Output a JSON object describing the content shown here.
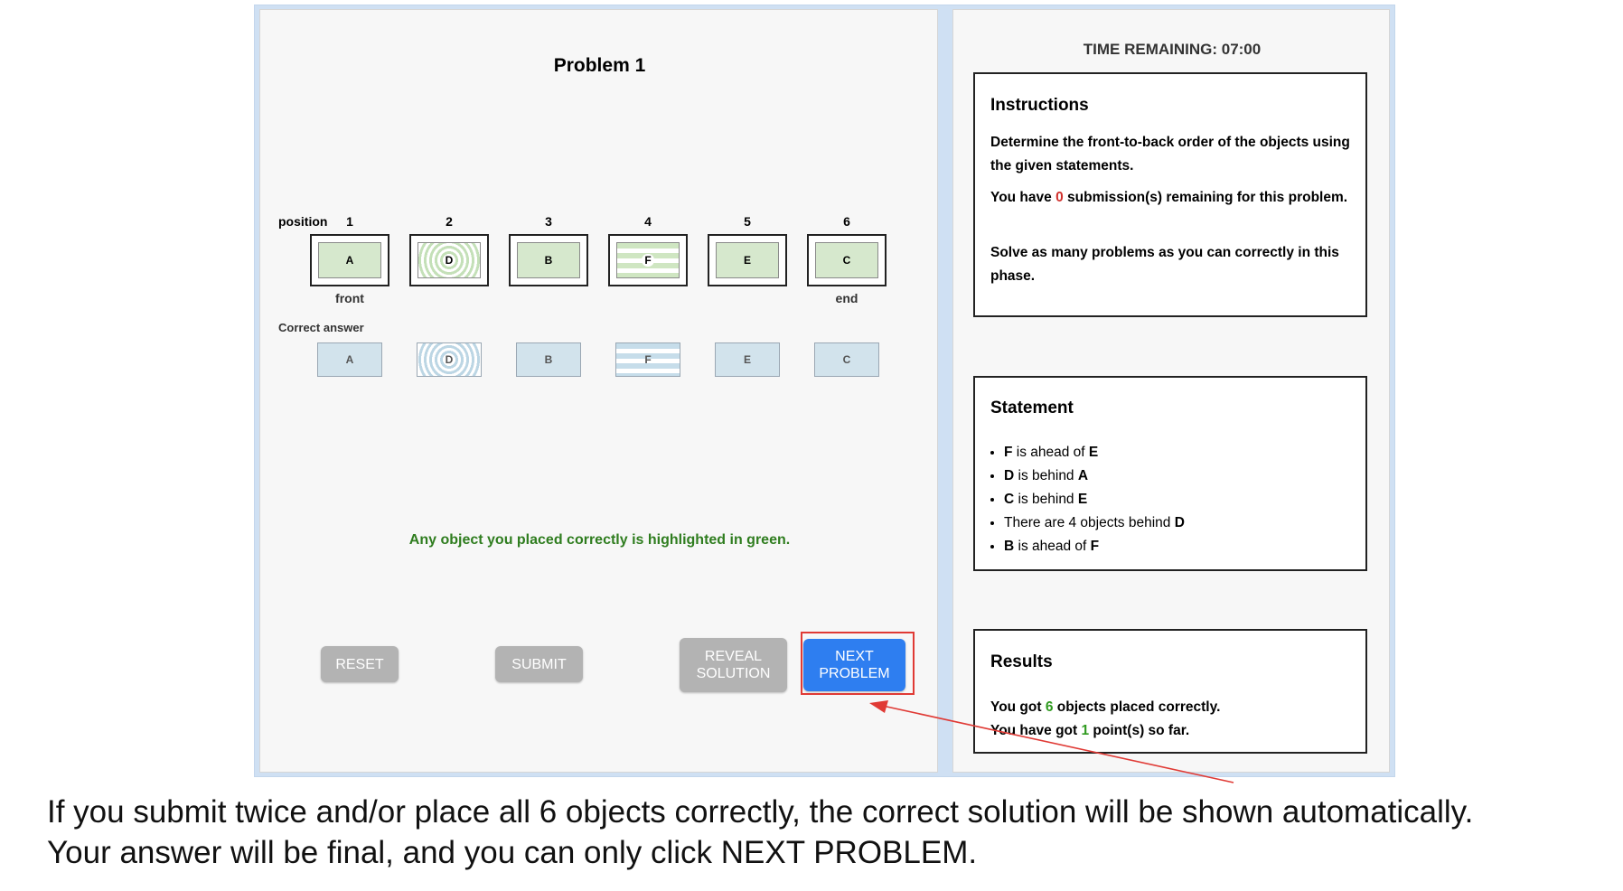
{
  "problem": {
    "title": "Problem 1"
  },
  "positions": {
    "header": "position",
    "numbers": [
      "1",
      "2",
      "3",
      "4",
      "5",
      "6"
    ],
    "front_label": "front",
    "end_label": "end"
  },
  "placed": [
    {
      "letter": "A",
      "pattern": "solid"
    },
    {
      "letter": "D",
      "pattern": "rings"
    },
    {
      "letter": "B",
      "pattern": "solid"
    },
    {
      "letter": "F",
      "pattern": "stripes"
    },
    {
      "letter": "E",
      "pattern": "solid"
    },
    {
      "letter": "C",
      "pattern": "solid"
    }
  ],
  "correct_answer": {
    "label": "Correct answer",
    "items": [
      {
        "letter": "A",
        "pattern": "solid"
      },
      {
        "letter": "D",
        "pattern": "rings"
      },
      {
        "letter": "B",
        "pattern": "solid"
      },
      {
        "letter": "F",
        "pattern": "stripes"
      },
      {
        "letter": "E",
        "pattern": "solid"
      },
      {
        "letter": "C",
        "pattern": "solid"
      }
    ]
  },
  "feedback": "Any object you placed correctly is highlighted in green.",
  "buttons": {
    "reset": "RESET",
    "submit": "SUBMIT",
    "reveal_line1": "REVEAL",
    "reveal_line2": "SOLUTION",
    "next_line1": "NEXT",
    "next_line2": "PROBLEM"
  },
  "timer": "TIME REMAINING: 07:00",
  "instructions": {
    "title": "Instructions",
    "p1": "Determine the front-to-back order of the objects using the given statements.",
    "p2_pre": "You have ",
    "p2_count": "0",
    "p2_post": " submission(s) remaining for this problem.",
    "p3": "Solve as many problems as you can correctly in this phase."
  },
  "statement": {
    "title": "Statement",
    "items": [
      {
        "a": "F",
        "mid": " is ahead of ",
        "b": "E"
      },
      {
        "a": "D",
        "mid": " is behind ",
        "b": "A"
      },
      {
        "a": "C",
        "mid": " is behind ",
        "b": "E"
      },
      {
        "a": "",
        "mid": "There are 4 objects behind ",
        "b": "D"
      },
      {
        "a": "B",
        "mid": " is ahead of ",
        "b": "F"
      }
    ]
  },
  "results": {
    "title": "Results",
    "line1_pre": "You got ",
    "line1_count": "6",
    "line1_post": " objects placed correctly.",
    "line2_pre": "You have got ",
    "line2_count": "1",
    "line2_post": " point(s) so far."
  },
  "caption": {
    "line1": "If you submit twice and/or place all 6 objects correctly, the correct solution will be shown automatically.",
    "line2": "Your answer will be final, and you can only click NEXT PROBLEM."
  },
  "colors": {
    "highlight_green": "#d6e8cd",
    "answer_blue": "#d2e3ec",
    "next_button": "#2e7ef0",
    "annotation_red": "#e03a35"
  }
}
